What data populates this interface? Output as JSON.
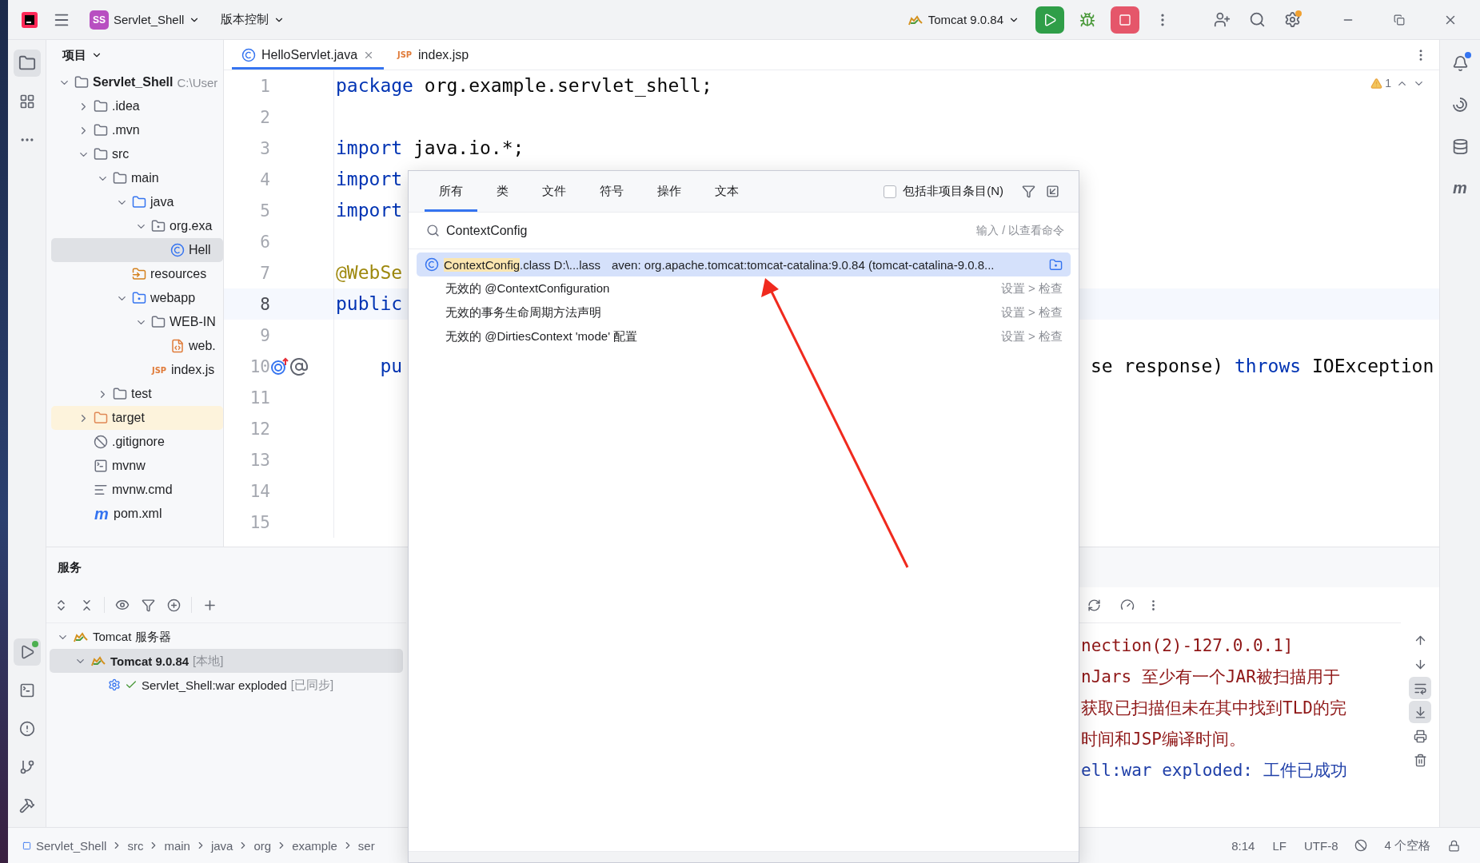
{
  "title_bar": {
    "project_badge": "SS",
    "project": "Servlet_Shell",
    "vcs": "版本控制",
    "run_config": "Tomcat 9.0.84"
  },
  "project_panel": {
    "title": "项目",
    "tree": [
      {
        "label": "Servlet_Shell",
        "path": "C:\\User",
        "kind": "project",
        "expanded": true,
        "selected": false,
        "children": [
          {
            "label": ".idea",
            "kind": "folder",
            "expanded": false,
            "selected": false
          },
          {
            "label": ".mvn",
            "kind": "folder",
            "expanded": false,
            "selected": false
          },
          {
            "label": "src",
            "kind": "folder",
            "expanded": true,
            "selected": false,
            "children": [
              {
                "label": "main",
                "kind": "folder",
                "expanded": true,
                "selected": false,
                "children": [
                  {
                    "label": "java",
                    "kind": "source-folder",
                    "expanded": true,
                    "selected": false,
                    "children": [
                      {
                        "label": "org.exa",
                        "kind": "package",
                        "expanded": true,
                        "selected": false,
                        "children": [
                          {
                            "label": "Hell",
                            "kind": "class",
                            "selected": true
                          }
                        ]
                      }
                    ]
                  },
                  {
                    "label": "resources",
                    "kind": "resources",
                    "selected": false
                  },
                  {
                    "label": "webapp",
                    "kind": "web-folder",
                    "expanded": true,
                    "selected": false,
                    "children": [
                      {
                        "label": "WEB-IN",
                        "kind": "folder",
                        "expanded": true,
                        "selected": false,
                        "children": [
                          {
                            "label": "web.",
                            "kind": "xml",
                            "selected": false
                          }
                        ]
                      },
                      {
                        "label": "index.js",
                        "kind": "jsp",
                        "badge": "JSP",
                        "selected": false
                      }
                    ]
                  }
                ]
              },
              {
                "label": "test",
                "kind": "folder",
                "expanded": false,
                "selected": false
              }
            ]
          },
          {
            "label": "target",
            "kind": "excluded-folder",
            "expanded": false,
            "selected": false
          },
          {
            "label": ".gitignore",
            "kind": "gitignore",
            "selected": false
          },
          {
            "label": "mvnw",
            "kind": "script",
            "selected": false
          },
          {
            "label": "mvnw.cmd",
            "kind": "text",
            "selected": false
          },
          {
            "label": "pom.xml",
            "kind": "maven",
            "badge": "m",
            "selected": false
          }
        ]
      }
    ]
  },
  "editor": {
    "tabs": [
      {
        "label": "HelloServlet.java",
        "kind": "class",
        "selected": true
      },
      {
        "label": "index.jsp",
        "kind": "jsp",
        "badge": "JSP",
        "selected": false
      }
    ],
    "warnings": "1",
    "lines": [
      {
        "num": "1",
        "current": false,
        "markers": false,
        "left": [
          {
            "text": "package",
            "kind": "keyword"
          },
          {
            "text": " org.example.servlet_shell;",
            "kind": "plain"
          }
        ]
      },
      {
        "num": "2",
        "current": false,
        "markers": false
      },
      {
        "num": "3",
        "current": false,
        "markers": false,
        "left": [
          {
            "text": "import",
            "kind": "keyword"
          },
          {
            "text": " java.io.*;",
            "kind": "plain"
          }
        ]
      },
      {
        "num": "4",
        "current": false,
        "markers": false,
        "left": [
          {
            "text": "import",
            "kind": "keyword"
          }
        ]
      },
      {
        "num": "5",
        "current": false,
        "markers": false,
        "left": [
          {
            "text": "import",
            "kind": "keyword"
          }
        ]
      },
      {
        "num": "6",
        "current": false,
        "markers": false
      },
      {
        "num": "7",
        "current": false,
        "markers": false,
        "left": [
          {
            "text": "@WebSe",
            "kind": "annotation"
          }
        ]
      },
      {
        "num": "8",
        "current": true,
        "markers": false,
        "left": [
          {
            "text": "public",
            "kind": "keyword"
          }
        ]
      },
      {
        "num": "9",
        "current": false,
        "markers": false
      },
      {
        "num": "10",
        "current": false,
        "markers": true,
        "left": [
          {
            "text": "    pu",
            "kind": "keyword"
          }
        ],
        "right": [
          {
            "text": "se response) ",
            "kind": "plain"
          },
          {
            "text": "throws",
            "kind": "keyword"
          },
          {
            "text": " IOException",
            "kind": "plain"
          }
        ]
      },
      {
        "num": "11",
        "current": false,
        "markers": false
      },
      {
        "num": "12",
        "current": false,
        "markers": false
      },
      {
        "num": "13",
        "current": false,
        "markers": false
      },
      {
        "num": "14",
        "current": false,
        "markers": false
      },
      {
        "num": "15",
        "current": false,
        "markers": false
      }
    ]
  },
  "search_popup": {
    "tabs": [
      {
        "label": "所有",
        "selected": true
      },
      {
        "label": "类",
        "selected": false
      },
      {
        "label": "文件",
        "selected": false
      },
      {
        "label": "符号",
        "selected": false
      },
      {
        "label": "操作",
        "selected": false
      },
      {
        "label": "文本",
        "selected": false
      }
    ],
    "include_non_project": {
      "label": "包括非项目条目(N)",
      "checked": false
    },
    "query": "ContextConfig",
    "hint": "输入 / 以查看命令",
    "results": [
      {
        "kind": "class",
        "match": "ContextConfig",
        "rest": ".class D:\\...lass",
        "location": "aven: org.apache.tomcat:tomcat-catalina:9.0.84 (tomcat-catalina-9.0.8...",
        "selected": true
      },
      {
        "kind": "inspection",
        "label": "无效的 @ContextConfiguration",
        "path": "设置 > 检查",
        "selected": false
      },
      {
        "kind": "inspection",
        "label": "无效的事务生命周期方法声明",
        "path": "设置 > 检查",
        "selected": false
      },
      {
        "kind": "inspection",
        "label": "无效的 @DirtiesContext 'mode' 配置",
        "path": "设置 > 检查",
        "selected": false
      }
    ]
  },
  "services": {
    "title": "服务",
    "tree": [
      {
        "label": "Tomcat 服务器",
        "kind": "server-group",
        "expanded": true,
        "selected": false,
        "children": [
          {
            "label": "Tomcat 9.0.84",
            "note": "[本地]",
            "kind": "server",
            "expanded": true,
            "selected": true,
            "children": [
              {
                "label": "Servlet_Shell:war exploded",
                "note": "[已同步]",
                "kind": "artifact",
                "selected": false
              }
            ]
          }
        ]
      }
    ],
    "console": [
      {
        "text": "nection(2)-127.0.0.1]",
        "kind": "stderr"
      },
      {
        "text": "nJars 至少有一个JAR被扫描用于",
        "kind": "stderr"
      },
      {
        "text": "获取已扫描但未在其中找到TLD的完",
        "kind": "stderr"
      },
      {
        "text": "时间和JSP编译时间。",
        "kind": "stderr"
      },
      {
        "text": "ell:war exploded: 工件已成功",
        "kind": "system"
      }
    ]
  },
  "right_strip": {
    "maven_badge": "m"
  },
  "status_bar": {
    "breadcrumb": [
      "Servlet_Shell",
      "src",
      "main",
      "java",
      "org",
      "example",
      "ser"
    ],
    "position": "8:14",
    "line_ending": "LF",
    "encoding": "UTF-8",
    "indent": "4 个空格"
  }
}
